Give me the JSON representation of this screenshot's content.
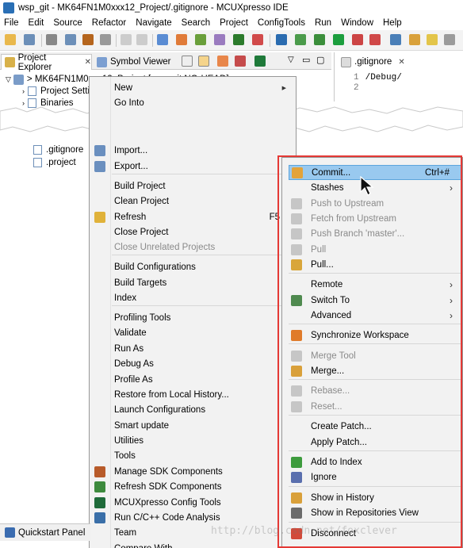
{
  "window": {
    "title": "wsp_git - MK64FN1M0xxx12_Project/.gitignore - MCUXpresso IDE"
  },
  "menubar": [
    "File",
    "Edit",
    "Source",
    "Refactor",
    "Navigate",
    "Search",
    "Project",
    "ConfigTools",
    "Run",
    "Window",
    "Help"
  ],
  "views": {
    "project_explorer": "Project Explorer",
    "symbol_viewer": "Symbol Viewer"
  },
  "editor": {
    "tab": ".gitignore",
    "lines": [
      {
        "n": "1",
        "text": "/Debug/"
      },
      {
        "n": "2",
        "text": ""
      }
    ]
  },
  "tree": {
    "project": "> MK64FN1M0xxx12_Project [wsp_git NO-HEAD]",
    "items_top": [
      "Project Setti",
      "Binaries"
    ],
    "items_bottom": [
      ".gitignore",
      ".project"
    ]
  },
  "context_menu_top": [
    {
      "label": "New",
      "arrow": "▶"
    },
    {
      "label": "Go Into",
      "arrow": ""
    }
  ],
  "context_menu": [
    {
      "label": "Import...",
      "icon": "import-icon"
    },
    {
      "label": "Export...",
      "icon": "export-icon"
    },
    {
      "label": "Build Project"
    },
    {
      "label": "Clean Project"
    },
    {
      "label": "Refresh",
      "accel": "F5",
      "icon": "refresh-icon"
    },
    {
      "label": "Close Project"
    },
    {
      "label": "Close Unrelated Projects",
      "disabled": true
    },
    {
      "label": "Build Configurations",
      "arrow": "▶"
    },
    {
      "label": "Build Targets",
      "arrow": "▶"
    },
    {
      "label": "Index",
      "arrow": "▶"
    },
    {
      "label": "Profiling Tools",
      "arrow": "▶"
    },
    {
      "label": "Validate"
    },
    {
      "label": "Run As",
      "arrow": "▶"
    },
    {
      "label": "Debug As",
      "arrow": "▶"
    },
    {
      "label": "Profile As",
      "arrow": "▶"
    },
    {
      "label": "Restore from Local History..."
    },
    {
      "label": "Launch Configurations"
    },
    {
      "label": "Smart update"
    },
    {
      "label": "Utilities",
      "arrow": "▶"
    },
    {
      "label": "Tools",
      "arrow": "▶"
    },
    {
      "label": "Manage SDK Components",
      "icon": "sdk-components-icon"
    },
    {
      "label": "Refresh SDK Components",
      "icon": "refresh-sdk-icon"
    },
    {
      "label": "MCUXpresso Config Tools",
      "icon": "config-tools-icon"
    },
    {
      "label": "Run C/C++ Code Analysis",
      "icon": "code-analysis-icon"
    },
    {
      "label": "Team",
      "arrow": "▶"
    },
    {
      "label": "Compare With"
    }
  ],
  "team_menu": [
    {
      "label": "Commit...",
      "accel": "Ctrl+#",
      "icon": "commit-icon",
      "selected": true
    },
    {
      "label": "Stashes",
      "arrow": "›"
    },
    {
      "label": "Push to Upstream",
      "disabled": true,
      "icon": "push-icon"
    },
    {
      "label": "Fetch from Upstream",
      "disabled": true,
      "icon": "fetch-icon"
    },
    {
      "label": "Push Branch 'master'...",
      "disabled": true,
      "icon": "push-branch-icon"
    },
    {
      "label": "Pull",
      "disabled": true,
      "icon": "pull-icon"
    },
    {
      "label": "Pull...",
      "icon": "pull-dialog-icon"
    },
    {
      "label": "Remote",
      "arrow": "›"
    },
    {
      "label": "Switch To",
      "arrow": "›",
      "icon": "switch-branch-icon"
    },
    {
      "label": "Advanced",
      "arrow": "›"
    },
    {
      "label": "Synchronize Workspace",
      "icon": "synchronize-icon"
    },
    {
      "label": "Merge Tool",
      "disabled": true,
      "icon": "merge-tool-icon"
    },
    {
      "label": "Merge...",
      "icon": "merge-icon"
    },
    {
      "label": "Rebase...",
      "disabled": true,
      "icon": "rebase-icon"
    },
    {
      "label": "Reset...",
      "disabled": true,
      "icon": "reset-icon"
    },
    {
      "label": "Create Patch..."
    },
    {
      "label": "Apply Patch..."
    },
    {
      "label": "Add to Index",
      "icon": "add-index-icon"
    },
    {
      "label": "Ignore",
      "icon": "ignore-icon"
    },
    {
      "label": "Show in History",
      "icon": "history-icon"
    },
    {
      "label": "Show in Repositories View",
      "icon": "repositories-icon"
    },
    {
      "label": "Disconnect",
      "icon": "disconnect-icon"
    }
  ],
  "bottom": {
    "quickstart": "Quickstart Panel",
    "watermark": "http://blog.csdn.net/foxclever"
  },
  "colors": {
    "selection": "#99c9ef",
    "highlight_box": "#e53935",
    "menu_bg": "#f2f2f2"
  }
}
